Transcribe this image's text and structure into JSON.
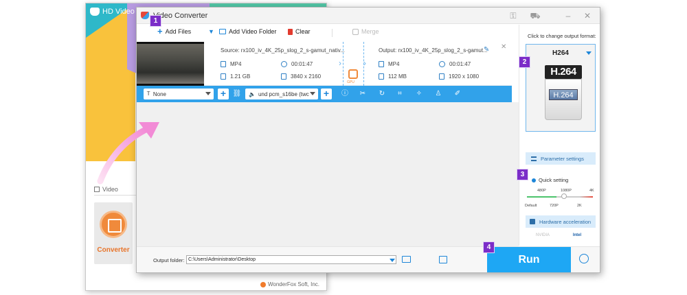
{
  "launcher": {
    "title": "HD Video C",
    "section_label": "Video",
    "converter_label": "Converter",
    "footer": "WonderFox Soft, Inc."
  },
  "window": {
    "title": "Video Converter"
  },
  "toolbar": {
    "add_files": "Add Files",
    "add_video_folder": "Add Video Folder",
    "clear": "Clear",
    "merge": "Merge"
  },
  "file": {
    "source_name": "Source: rx100_iv_4K_25p_slog_2_s-gamut_nativ...",
    "output_name": "Output: rx100_iv_4K_25p_slog_2_s-gamut...",
    "source": {
      "format": "MP4",
      "duration": "00:01:47",
      "size": "1.21 GB",
      "resolution": "3840 x 2160"
    },
    "output": {
      "format": "MP4",
      "duration": "00:01:47",
      "size": "112 MB",
      "resolution": "1920 x 1080"
    },
    "gpu_label": "GPU"
  },
  "edit_bar": {
    "subtitle_value": "None",
    "audio_value": "und pcm_s16be (twc"
  },
  "right_panel": {
    "hint": "Click to change output format:",
    "format_name": "H264",
    "format_logo_top": "H.264",
    "format_logo_bottom": "H.264",
    "parameter_settings": "Parameter settings",
    "quick_setting": "Quick setting",
    "quality_top": [
      "480P",
      "1080P",
      "4K"
    ],
    "quality_bottom": [
      "Default",
      "720P",
      "2K"
    ],
    "quality_level": 0.5,
    "hardware_acceleration": "Hardware acceleration",
    "vendors": [
      "NVIDIA",
      "Intel"
    ]
  },
  "bottom": {
    "output_folder_label": "Output folder:",
    "output_folder_path": "C:\\Users\\Administrator\\Desktop",
    "run": "Run"
  },
  "badges": [
    "1",
    "2",
    "3",
    "4"
  ],
  "colors": {
    "accent_blue": "#1ea7f4",
    "badge_purple": "#7b2dc8",
    "arrow_pink": "#f28bd6"
  }
}
